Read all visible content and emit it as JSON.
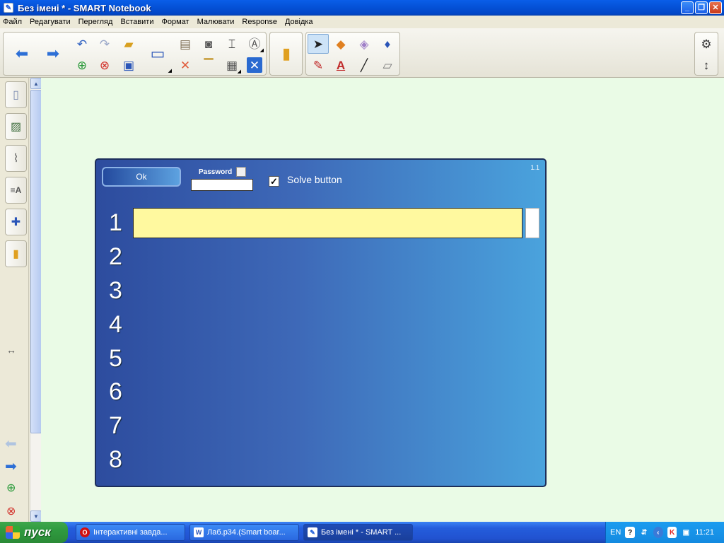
{
  "window": {
    "title": "Без імені * - SMART Notebook",
    "app_icon": "notebook-icon"
  },
  "menu": [
    "Файл",
    "Редагувати",
    "Перегляд",
    "Вставити",
    "Формат",
    "Малювати",
    "Response",
    "Довідка"
  ],
  "toolbar": {
    "tools": [
      "back-arrow-icon",
      "forward-arrow-icon",
      "undo-icon",
      "redo-icon",
      "add-page-icon",
      "delete-page-icon",
      "open-icon",
      "save-icon",
      "display-icon",
      "paste-icon",
      "delete-icon",
      "screenshade-icon",
      "fullscreen-icon",
      "table-icon",
      "capture-icon",
      "gallery-icon",
      "response-icon",
      "select-icon",
      "shapes-icon",
      "magic-pen-icon",
      "fill-icon",
      "pens-icon",
      "text-icon",
      "line-icon",
      "eraser-icon",
      "settings-icon",
      "move-toolbar-icon"
    ],
    "selected_tool": "select"
  },
  "sidebar": {
    "tabs": [
      "page-sorter-icon",
      "gallery-icon",
      "attachments-icon",
      "properties-icon",
      "addons-icon",
      "response-icon"
    ],
    "resize_icon": "resize-icon",
    "nav": [
      "prev-page-icon",
      "next-page-icon",
      "add-page-icon",
      "delete-page-icon"
    ]
  },
  "widget": {
    "ok_label": "Ok",
    "password_label": "Password",
    "solve_label": "Solve button",
    "solve_checked": true,
    "version": "1.1",
    "rows": [
      "1",
      "2",
      "3",
      "4",
      "5",
      "6",
      "7",
      "8"
    ],
    "colors": {
      "answer_fill": "#fff99f",
      "gradient_start": "#2d4c9e",
      "gradient_end": "#4aa3dd"
    }
  },
  "taskbar": {
    "start_label": "пуск",
    "tasks": [
      {
        "label": "Інтерактивні завда...",
        "icon": "opera-icon"
      },
      {
        "label": "Лаб.р34.(Smart boar...",
        "icon": "word-icon"
      },
      {
        "label": "Без імені * - SMART ...",
        "icon": "notebook-icon",
        "active": true
      }
    ],
    "tray": {
      "lang": "EN",
      "clock": "11:21"
    }
  }
}
